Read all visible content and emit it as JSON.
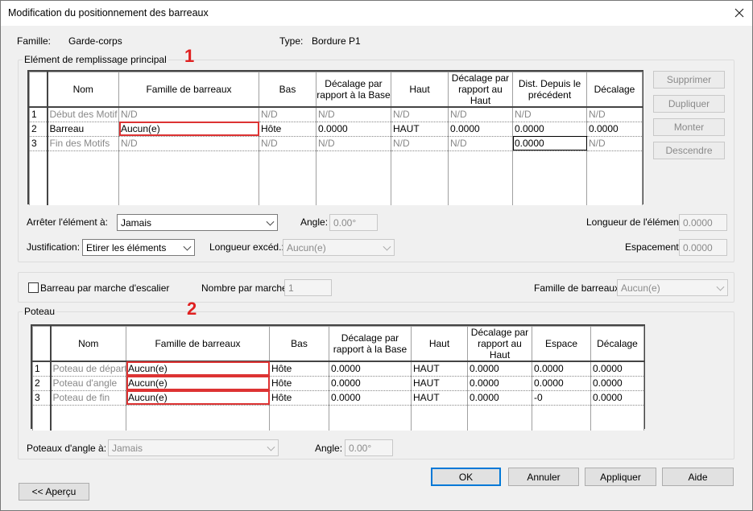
{
  "window": {
    "title": "Modification du positionnement des barreaux"
  },
  "header": {
    "famille_label": "Famille:",
    "famille_value": "Garde-corps",
    "type_label": "Type:",
    "type_value": "Bordure P1"
  },
  "main_group": {
    "label": "Elément de remplissage principal",
    "annotation": "1",
    "columns": [
      "Nom",
      "Famille de barreaux",
      "Bas",
      "Décalage par rapport à la Base",
      "Haut",
      "Décalage par rapport au Haut",
      "Dist. Depuis le précédent",
      "Décalage"
    ],
    "rows": [
      {
        "num": "1",
        "cells": [
          "Début des Motif",
          "N/D",
          "N/D",
          "N/D",
          "N/D",
          "N/D",
          "N/D",
          "N/D"
        ]
      },
      {
        "num": "2",
        "cells": [
          "Barreau",
          "Aucun(e)",
          "Hôte",
          "0.0000",
          "HAUT",
          "0.0000",
          "0.0000",
          "0.0000"
        ]
      },
      {
        "num": "3",
        "cells": [
          "Fin des Motifs",
          "N/D",
          "N/D",
          "N/D",
          "N/D",
          "N/D",
          "0.0000",
          "N/D"
        ]
      }
    ],
    "buttons": {
      "delete": "Supprimer",
      "duplicate": "Dupliquer",
      "up": "Monter",
      "down": "Descendre"
    },
    "stop_label": "Arrêter l'élément à:",
    "stop_value": "Jamais",
    "angle_label": "Angle:",
    "angle_value": "0.00°",
    "length_label": "Longueur de l'élément:",
    "length_value": "0.0000",
    "justification_label": "Justification:",
    "justification_value": "Etirer les éléments",
    "excess_label": "Longueur excéd.:",
    "excess_value": "Aucun(e)",
    "spacing_label": "Espacement:",
    "spacing_value": "0.0000"
  },
  "stair_group": {
    "checkbox_label": "Barreau par marche d'escalier",
    "count_label": "Nombre par marche:",
    "count_value": "1",
    "family_label": "Famille de barreaux:",
    "family_value": "Aucun(e)"
  },
  "post_group": {
    "label": "Poteau",
    "annotation": "2",
    "columns": [
      "Nom",
      "Famille de barreaux",
      "Bas",
      "Décalage par rapport à la Base",
      "Haut",
      "Décalage par rapport au Haut",
      "Espace",
      "Décalage"
    ],
    "rows": [
      {
        "num": "1",
        "cells": [
          "Poteau de départ",
          "Aucun(e)",
          "Hôte",
          "0.0000",
          "HAUT",
          "0.0000",
          "0.0000",
          "0.0000"
        ]
      },
      {
        "num": "2",
        "cells": [
          "Poteau d'angle",
          "Aucun(e)",
          "Hôte",
          "0.0000",
          "HAUT",
          "0.0000",
          "0.0000",
          "0.0000"
        ]
      },
      {
        "num": "3",
        "cells": [
          "Poteau de fin",
          "Aucun(e)",
          "Hôte",
          "0.0000",
          "HAUT",
          "0.0000",
          "-0",
          "0.0000"
        ]
      }
    ],
    "corner_label": "Poteaux d'angle à:",
    "corner_value": "Jamais",
    "angle_label": "Angle:",
    "angle_value": "0.00°"
  },
  "footer": {
    "ok": "OK",
    "cancel": "Annuler",
    "apply": "Appliquer",
    "help": "Aide",
    "preview": "<< Aperçu"
  }
}
